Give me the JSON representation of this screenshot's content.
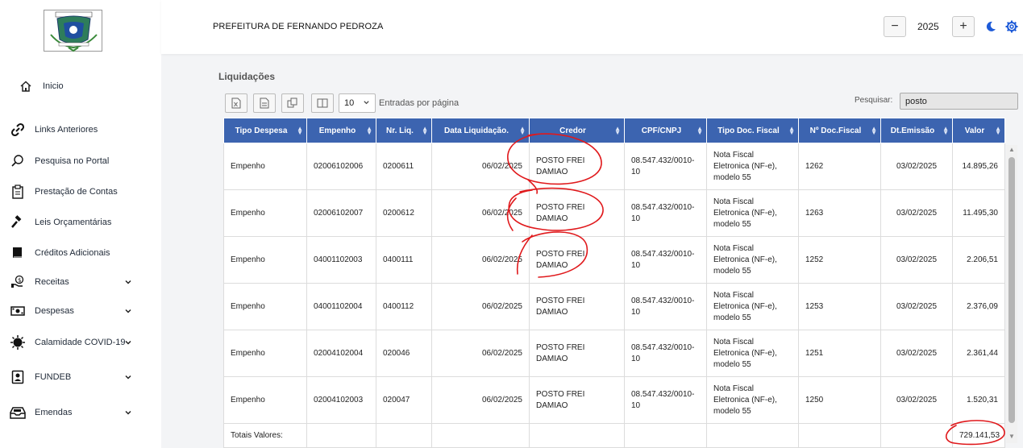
{
  "sidebar": {
    "items": [
      {
        "label": "Inicio",
        "icon": "home-icon",
        "expandable": false
      },
      {
        "label": "Links Anteriores",
        "icon": "link-icon",
        "expandable": false
      },
      {
        "label": "Pesquisa no Portal",
        "icon": "search-icon",
        "expandable": false
      },
      {
        "label": "Prestação de Contas",
        "icon": "clipboard-icon",
        "expandable": false
      },
      {
        "label": "Leis Orçamentárias",
        "icon": "gavel-icon",
        "expandable": false
      },
      {
        "label": "Créditos Adicionais",
        "icon": "book-icon",
        "expandable": false
      },
      {
        "label": "Receitas",
        "icon": "money-hand-icon",
        "expandable": true
      },
      {
        "label": "Despesas",
        "icon": "cash-icon",
        "expandable": true
      },
      {
        "label": "Calamidade COVID-19",
        "icon": "virus-icon",
        "expandable": true
      },
      {
        "label": "FUNDEB",
        "icon": "id-badge-icon",
        "expandable": true
      },
      {
        "label": "Emendas",
        "icon": "inbox-icon",
        "expandable": true
      }
    ]
  },
  "header": {
    "title": "PREFEITURA DE FERNANDO PEDROZA",
    "year": "2025",
    "minus": "−",
    "plus": "+"
  },
  "main": {
    "section_title": "Liquidações",
    "page_length": "10",
    "page_length_label": "Entradas por página",
    "search_label": "Pesquisar:",
    "search_value": "posto",
    "columns": [
      "Tipo Despesa",
      "Empenho",
      "Nr. Liq.",
      "Data Liquidação.",
      "Credor",
      "CPF/CNPJ",
      "Tipo Doc. Fiscal",
      "Nº Doc.Fiscal",
      "Dt.Emissão",
      "Valor"
    ],
    "rows": [
      [
        "Empenho",
        "02006102006",
        "0200611",
        "06/02/2025",
        "POSTO FREI DAMIAO",
        "08.547.432/0010-10",
        "Nota Fiscal Eletronica (NF-e), modelo 55",
        "1262",
        "03/02/2025",
        "14.895,26"
      ],
      [
        "Empenho",
        "02006102007",
        "0200612",
        "06/02/2025",
        "POSTO FREI DAMIAO",
        "08.547.432/0010-10",
        "Nota Fiscal Eletronica (NF-e), modelo 55",
        "1263",
        "03/02/2025",
        "11.495,30"
      ],
      [
        "Empenho",
        "04001102003",
        "0400111",
        "06/02/2025",
        "POSTO FREI DAMIAO",
        "08.547.432/0010-10",
        "Nota Fiscal Eletronica (NF-e), modelo 55",
        "1252",
        "03/02/2025",
        "2.206,51"
      ],
      [
        "Empenho",
        "04001102004",
        "0400112",
        "06/02/2025",
        "POSTO FREI DAMIAO",
        "08.547.432/0010-10",
        "Nota Fiscal Eletronica (NF-e), modelo 55",
        "1253",
        "03/02/2025",
        "2.376,09"
      ],
      [
        "Empenho",
        "02004102004",
        "020046",
        "06/02/2025",
        "POSTO FREI DAMIAO",
        "08.547.432/0010-10",
        "Nota Fiscal Eletronica (NF-e), modelo 55",
        "1251",
        "03/02/2025",
        "2.361,44"
      ],
      [
        "Empenho",
        "02004102003",
        "020047",
        "06/02/2025",
        "POSTO FREI DAMIAO",
        "08.547.432/0010-10",
        "Nota Fiscal Eletronica (NF-e), modelo 55",
        "1250",
        "03/02/2025",
        "1.520,31"
      ]
    ],
    "totals_label": "Totais Valores:",
    "totals_value": "729.141,53"
  },
  "colors": {
    "table_header": "#3c64b0",
    "accent_blue": "#1e5bd8",
    "annotation_red": "#e0191c"
  }
}
